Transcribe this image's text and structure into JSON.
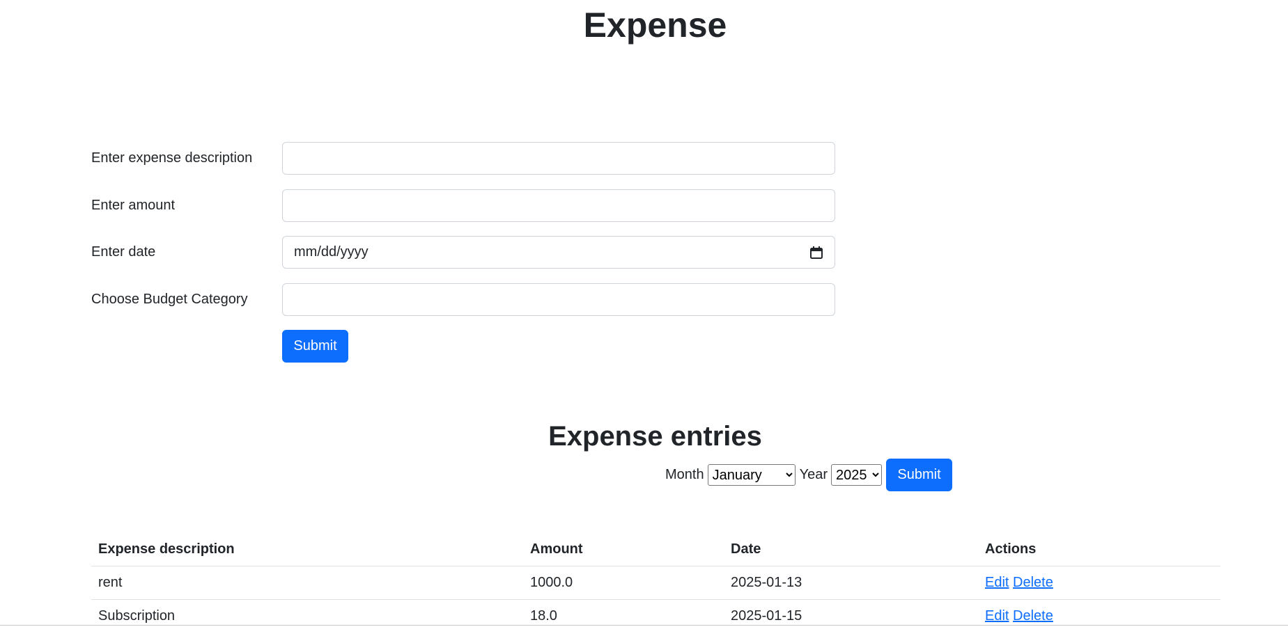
{
  "page": {
    "title": "Expense"
  },
  "form": {
    "description_label": "Enter expense description",
    "description_value": "",
    "amount_label": "Enter amount",
    "amount_value": "",
    "date_label": "Enter date",
    "date_placeholder": "mm/dd/yyyy",
    "category_label": "Choose Budget Category",
    "category_value": "",
    "submit_label": "Submit"
  },
  "entries": {
    "title": "Expense entries",
    "filter": {
      "month_label": "Month",
      "month_selected": "January",
      "year_label": "Year",
      "year_selected": "2025",
      "submit_label": "Submit"
    },
    "table": {
      "headers": [
        "Expense description",
        "Amount",
        "Date",
        "Actions"
      ],
      "rows": [
        {
          "description": "rent",
          "amount": "1000.0",
          "date": "2025-01-13",
          "edit": "Edit",
          "delete": "Delete"
        },
        {
          "description": "Subscription",
          "amount": "18.0",
          "date": "2025-01-15",
          "edit": "Edit",
          "delete": "Delete"
        }
      ]
    }
  },
  "colors": {
    "primary": "#0d6efd",
    "text": "#212529",
    "border": "#ced4da"
  },
  "icons": {
    "date_picker": "calendar-icon"
  }
}
